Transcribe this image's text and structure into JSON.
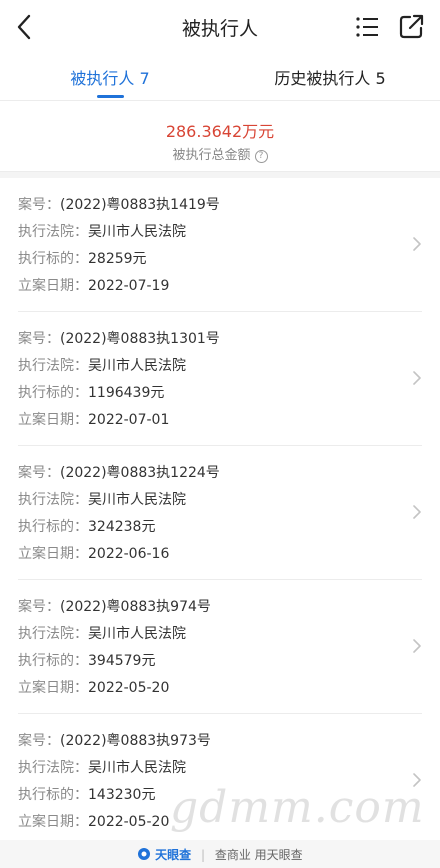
{
  "nav": {
    "title": "被执行人",
    "back_icon": "chevron-left-icon",
    "list_icon": "list-icon",
    "share_icon": "share-icon"
  },
  "tabs": [
    {
      "label": "被执行人 7",
      "active": true
    },
    {
      "label": "历史被执行人 5",
      "active": false
    }
  ],
  "summary": {
    "amount": "286.3642万元",
    "label": "被执行总金额",
    "help_icon": "question-circle-icon"
  },
  "field_labels": {
    "case_no": "案号：",
    "court": "执行法院：",
    "target": "执行标的：",
    "date": "立案日期："
  },
  "cases": [
    {
      "case_no": "(2022)粤0883执1419号",
      "court": "吴川市人民法院",
      "target": "28259元",
      "date": "2022-07-19"
    },
    {
      "case_no": "(2022)粤0883执1301号",
      "court": "吴川市人民法院",
      "target": "1196439元",
      "date": "2022-07-01"
    },
    {
      "case_no": "(2022)粤0883执1224号",
      "court": "吴川市人民法院",
      "target": "324238元",
      "date": "2022-06-16"
    },
    {
      "case_no": "(2022)粤0883执974号",
      "court": "吴川市人民法院",
      "target": "394579元",
      "date": "2022-05-20"
    },
    {
      "case_no": "(2022)粤0883执973号",
      "court": "吴川市人民法院",
      "target": "143230元",
      "date": "2022-05-20"
    }
  ],
  "footer": {
    "brand": "天眼查",
    "slogan": "查商业 用天眼查"
  },
  "watermark": "gdmm.com",
  "colors": {
    "accent": "#1f72d9",
    "amount": "#d84535"
  }
}
